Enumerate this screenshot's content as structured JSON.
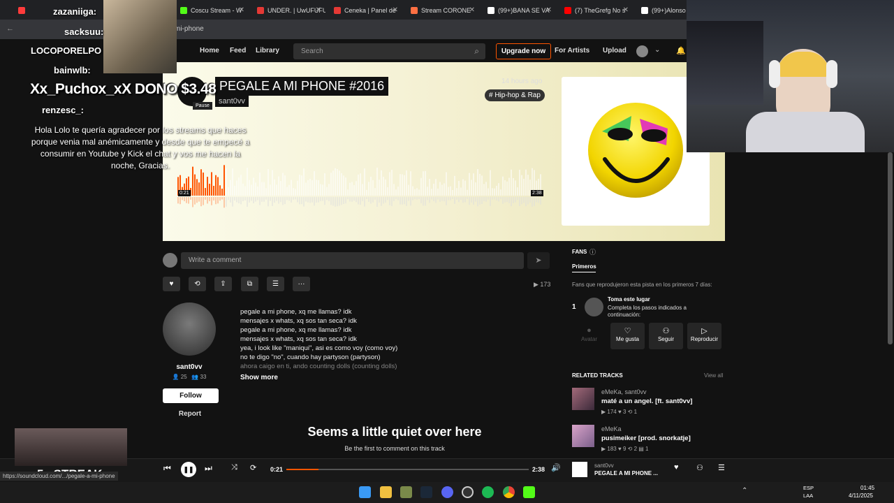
{
  "browser": {
    "tabs": [
      {
        "label": "zazaniiga: ...",
        "color": "#ff3b3b"
      },
      {
        "label": "Coscu Stream - W",
        "color": "#53fc18"
      },
      {
        "label": "UNDER. | UwUFUFU",
        "color": "#e53935"
      },
      {
        "label": "Ceneka | Panel de",
        "color": "#e53935"
      },
      {
        "label": "Stream CORONE",
        "color": "#ff7043"
      },
      {
        "label": "(99+)BANA SE VA",
        "color": "#ffffff"
      },
      {
        "label": "(7) TheGrefg No s",
        "color": "#ff0000"
      },
      {
        "label": "(99+)Alonso e",
        "color": "#ffffff"
      }
    ],
    "url": "mi-phone",
    "status_url": "https://soundcloud.com/.../pegale-a-mi-phone"
  },
  "nav": {
    "home": "Home",
    "feed": "Feed",
    "library": "Library",
    "search_placeholder": "Search",
    "upgrade": "Upgrade now",
    "for_artists": "For Artists",
    "upload": "Upload"
  },
  "track": {
    "title": "PEGALE A MI PHONE #2016",
    "artist": "sant0vv",
    "time_ago": "14 hours ago",
    "genre": "# Hip-hop & Rap",
    "elapsed_wave": "0:21",
    "duration_wave": "2:38",
    "pause_tooltip": "Pause",
    "progress": 0.133
  },
  "comment": {
    "placeholder": "Write a comment"
  },
  "actions": {
    "play_count": "173"
  },
  "artist": {
    "name": "sant0vv",
    "followers": "25",
    "following": "33",
    "follow": "Follow",
    "report": "Report"
  },
  "description": {
    "lines": [
      "pegale a mi phone, xq me llamas? idk",
      "mensajes x whats, xq sos tan seca? idk",
      "pegale a mi phone, xq me llamas? idk",
      "mensajes x whats, xq sos tan seca? idk",
      "yea, i look like \"maniqui\", asi es como voy (como voy)",
      "no te digo \"no\", cuando hay partyson (partyson)",
      "ahora caigo en ti, ando counting dolls (counting dolls)"
    ],
    "show_more": "Show more"
  },
  "comments_empty": {
    "title": "Seems a little quiet over here",
    "subtitle": "Be the first to comment on this track"
  },
  "fans": {
    "heading": "FANS",
    "tab": "Primeros",
    "desc": "Fans que reprodujeron esta pista en los primeros 7 días:",
    "rank": "1",
    "spot_title": "Toma este lugar",
    "spot_desc": "Completa los pasos indicados a continuación:",
    "steps": [
      "Avatar",
      "Me gusta",
      "Seguir",
      "Reproducir"
    ]
  },
  "related": {
    "heading": "RELATED TRACKS",
    "view_all": "View all",
    "tracks": [
      {
        "artist": "eMeKa, sant0vv",
        "title": "maté a un angel. [ft. sant0vv]",
        "plays": "174",
        "likes": "3",
        "reposts": "1",
        "comments": ""
      },
      {
        "artist": "eMeKa",
        "title": "pusimeiker [prod. snorkatje]",
        "plays": "183",
        "likes": "9",
        "reposts": "2",
        "comments": "1"
      }
    ]
  },
  "player": {
    "elapsed": "0:21",
    "duration": "2:38",
    "artist": "sant0vv",
    "title": "PEGALE A MI PHONE ...",
    "progress": 0.133
  },
  "taskbar": {
    "lang1": "ESP",
    "lang2": "LAA",
    "time": "01:45",
    "date": "4/11/2025"
  },
  "overlay": {
    "chat": [
      {
        "user": "zazaniiga:"
      },
      {
        "user": "sacksuu:"
      },
      {
        "user": "LOCOPORELPO"
      },
      {
        "user": "bainwlb:"
      },
      {
        "user": "renzesc_:"
      }
    ],
    "donation_name": "Xx_Puchox_xX DONO $3.48",
    "donation_msg": "Hola Lolo te quería agradecer por los streams que haces porque venia mal anémicamente y desde que te empecé a consumir en Youtube y Kick el chat y vos me hacen la noche, Gracias.",
    "streak": "5x STREAK"
  },
  "colors": {
    "accent": "#ff5500",
    "bg": "#121212"
  }
}
